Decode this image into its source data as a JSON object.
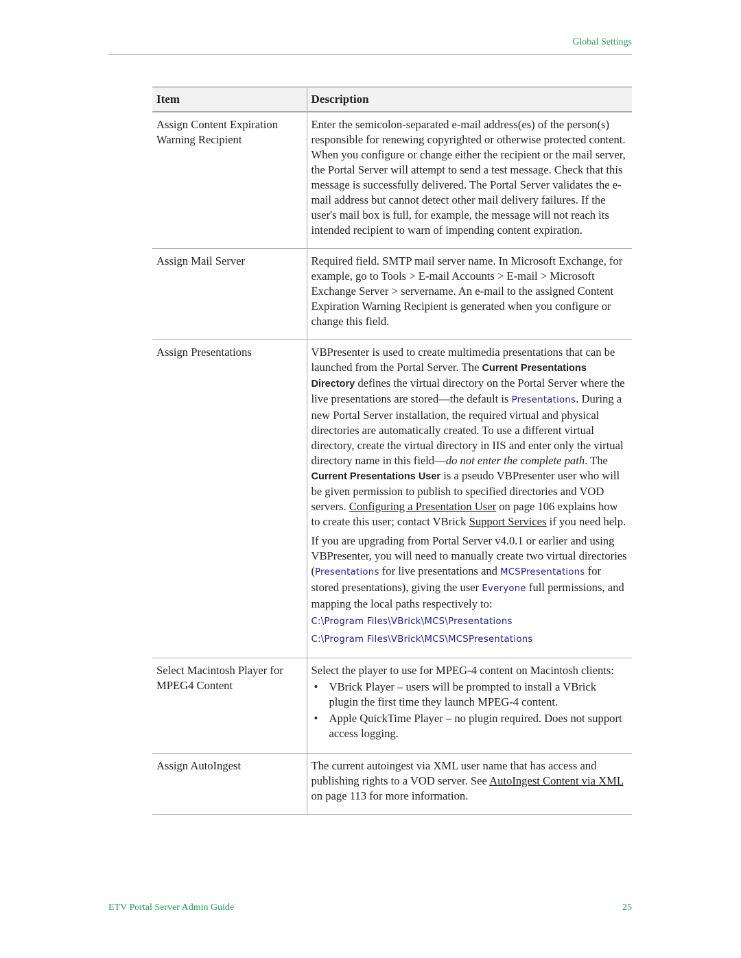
{
  "header": {
    "section_title": "Global Settings"
  },
  "table": {
    "columns": [
      "Item",
      "Description"
    ],
    "rows": [
      {
        "item": "Assign Content Expiration Warning Recipient",
        "desc": "Enter the semicolon-separated e-mail address(es) of the person(s) responsible for renewing copyrighted or otherwise protected content. When you configure or change either the recipient or the mail server, the Portal Server will attempt to send a test message. Check that this message is successfully delivered. The Portal Server validates the e-mail address but cannot detect other mail delivery failures. If the user's mail box is full, for example, the message will not reach its intended recipient to warn of impending content expiration."
      },
      {
        "item": "Assign Mail Server",
        "desc": "Required field. SMTP mail server name. In Microsoft Exchange, for example, go to Tools > E-mail Accounts > E-mail > Microsoft Exchange Server > servername. An e-mail to the assigned Content Expiration Warning Recipient is generated when you configure or change this field."
      },
      {
        "item": "Assign Presentations",
        "p1": {
          "t1": "VBPresenter is used to create multimedia presentations that can be launched from the Portal Server. The ",
          "b1": "Current Presentations Directory",
          "t2": " defines the virtual directory on the Portal Server where the live presentations are stored—the default is ",
          "c1": "Presentations",
          "t3": ". During a new Portal Server installation, the required virtual and physical directories are automatically created. To use a different virtual directory, create the virtual directory in IIS and enter only the virtual directory name in this field—",
          "i1": "do not enter the complete path",
          "t4": ". The ",
          "b2": "Current Presentations User",
          "t5": " is a pseudo VBPresenter user who will be given permission to publish to specified directories and VOD servers. ",
          "link1": "Configuring a Presentation User",
          "t6": " on page 106 explains how to create this user; contact VBrick ",
          "link2": "Support Services",
          "t7": " if you need help."
        },
        "p2": {
          "t1": "If you are upgrading from Portal Server v4.0.1 or earlier and using VBPresenter, you will need to manually create two virtual directories (",
          "c1": "Presentations",
          "t2": " for live presentations and ",
          "c2": "MCSPresentations",
          "t3": " for stored presentations), giving the user ",
          "c3": "Everyone",
          "t4": " full permissions, and mapping the local paths respectively to:"
        },
        "paths": [
          "C:\\Program Files\\VBrick\\MCS\\Presentations",
          "C:\\Program Files\\VBrick\\MCS\\MCSPresentations"
        ]
      },
      {
        "item": "Select Macintosh Player for MPEG4 Content",
        "intro": "Select the player to use for MPEG-4 content on Macintosh clients:",
        "bullet_glyph": "•",
        "bullets": [
          "VBrick Player – users will be prompted to install a VBrick plugin the first time they launch MPEG-4 content.",
          "Apple QuickTime Player – no plugin required. Does not support access logging."
        ]
      },
      {
        "item": "Assign AutoIngest",
        "t1": "The current autoingest via XML user name that has access and publishing rights to a VOD server. See ",
        "link1": "AutoIngest Content via XML",
        "t2": " on page 113 for more information."
      }
    ]
  },
  "footer": {
    "guide_title": "ETV Portal Server Admin Guide",
    "page_number": "25"
  }
}
